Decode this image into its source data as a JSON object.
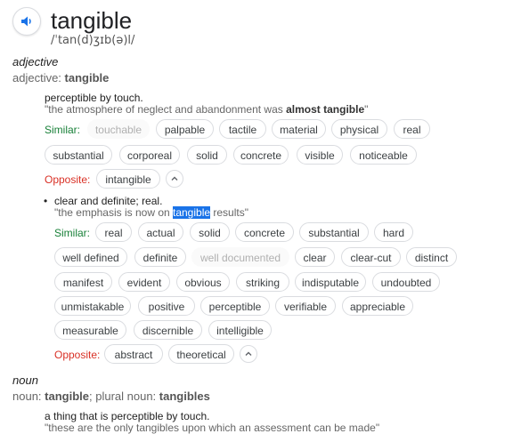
{
  "header": {
    "word": "tangible",
    "phonetic": "/ˈtan(d)ʒɪb(ə)l/"
  },
  "adjective": {
    "pos": "adjective",
    "pos_prefix": "adjective: ",
    "pos_word": "tangible",
    "sense1": {
      "definition": "perceptible by touch.",
      "example_pre": "\"the atmosphere of neglect and abandonment was ",
      "example_bold": "almost tangible",
      "example_post": "\"",
      "similar_label": "Similar:",
      "similar": [
        "touchable",
        "palpable",
        "tactile",
        "material",
        "physical",
        "real",
        "substantial",
        "corporeal",
        "solid",
        "concrete",
        "visible",
        "noticeable"
      ],
      "opposite_label": "Opposite:",
      "opposite": [
        "intangible"
      ]
    },
    "sense2": {
      "bullet": "•",
      "definition": "clear and definite; real.",
      "example_pre": "\"the emphasis is now on ",
      "example_highlight": "tangible",
      "example_post": " results\"",
      "similar_label": "Similar:",
      "similar": [
        "real",
        "actual",
        "solid",
        "concrete",
        "substantial",
        "hard",
        "well defined",
        "definite",
        "well documented",
        "clear",
        "clear-cut",
        "distinct",
        "manifest",
        "evident",
        "obvious",
        "striking",
        "indisputable",
        "undoubted",
        "unmistakable",
        "positive",
        "perceptible",
        "verifiable",
        "appreciable",
        "measurable",
        "discernible",
        "intelligible"
      ],
      "opposite_label": "Opposite:",
      "opposite": [
        "abstract",
        "theoretical"
      ]
    }
  },
  "noun": {
    "pos": "noun",
    "pos_prefix": "noun: ",
    "pos_word": "tangible",
    "plural_sep": "; plural noun: ",
    "plural_word": "tangibles",
    "definition": "a thing that is perceptible by touch.",
    "example": "\"these are the only tangibles upon which an assessment can be made\""
  },
  "colors": {
    "similar": "#188038",
    "opposite": "#d93025",
    "highlight": "#1a73e8",
    "speaker": "#1a73e8"
  },
  "icons": {
    "speaker": "speaker-icon",
    "collapse": "chevron-up-icon"
  }
}
